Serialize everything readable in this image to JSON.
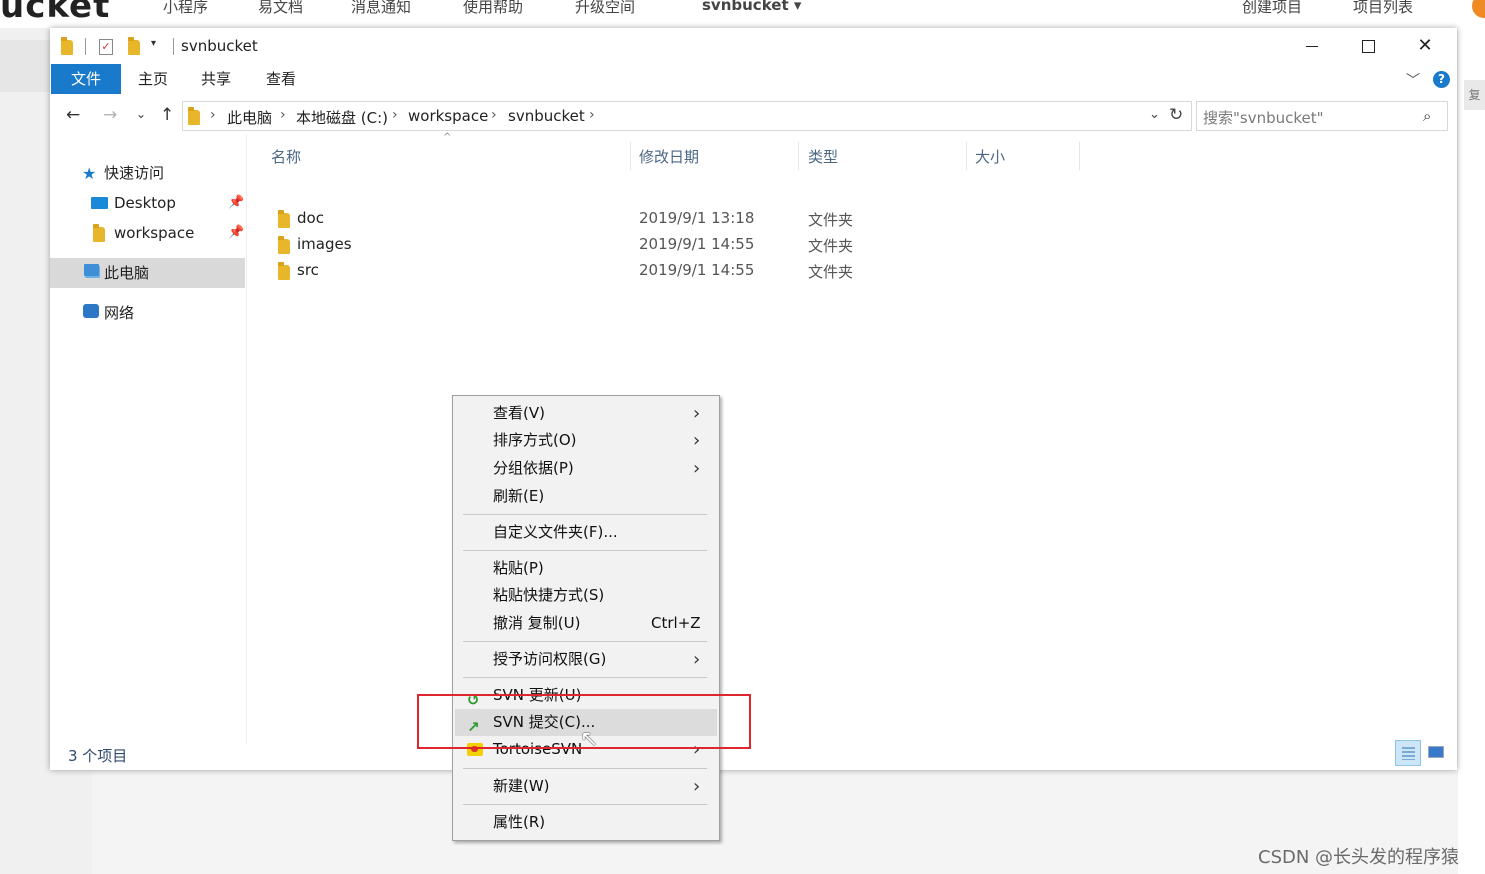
{
  "background_page": {
    "brand": "ucket",
    "nav": [
      "小程序",
      "易文档",
      "消息通知",
      "使用帮助",
      "升级空间",
      "svnbucket ▾"
    ],
    "right_nav": [
      "创建项目",
      "项目列表"
    ],
    "right_chip": "复"
  },
  "window": {
    "title": "svnbucket",
    "quick_access_dropdown": "▾",
    "controls": {
      "close": "✕"
    }
  },
  "ribbon": {
    "tabs": [
      "文件",
      "主页",
      "共享",
      "查看"
    ],
    "expand_icon": "﹀",
    "help": "?"
  },
  "nav": {
    "back": "←",
    "forward": "→",
    "recent": "⌄",
    "up": "↑",
    "breadcrumb": [
      "此电脑",
      "本地磁盘 (C:)",
      "workspace",
      "svnbucket"
    ],
    "crumb_separator": "›",
    "address_dropdown": "⌄",
    "refresh": "↻",
    "search_placeholder": "搜索\"svnbucket\"",
    "search_icon": "⌕"
  },
  "sidebar": {
    "quick_access": "快速访问",
    "star": "★",
    "pin": "📌",
    "items": [
      "Desktop",
      "workspace"
    ],
    "this_pc": "此电脑",
    "network": "网络"
  },
  "list": {
    "sort_indicator": "^",
    "columns": [
      "名称",
      "修改日期",
      "类型",
      "大小"
    ],
    "rows": [
      {
        "name": "doc",
        "date": "2019/9/1 13:18",
        "type": "文件夹"
      },
      {
        "name": "images",
        "date": "2019/9/1 14:55",
        "type": "文件夹"
      },
      {
        "name": "src",
        "date": "2019/9/1 14:55",
        "type": "文件夹"
      }
    ]
  },
  "status": {
    "count": "3 个项目"
  },
  "context_menu": {
    "submenu_arrow": "›",
    "svn_update_glyph": "↺",
    "svn_commit_glyph": "↗",
    "items": [
      {
        "label": "查看(V)"
      },
      {
        "label": "排序方式(O)"
      },
      {
        "label": "分组依据(P)"
      },
      {
        "label": "刷新(E)"
      },
      {
        "label": "自定义文件夹(F)..."
      },
      {
        "label": "粘贴(P)"
      },
      {
        "label": "粘贴快捷方式(S)"
      },
      {
        "label": "撤消 复制(U)",
        "shortcut": "Ctrl+Z"
      },
      {
        "label": "授予访问权限(G)"
      },
      {
        "label": "SVN 更新(U)"
      },
      {
        "label": "SVN 提交(C)..."
      },
      {
        "label": "TortoiseSVN"
      },
      {
        "label": "新建(W)"
      },
      {
        "label": "属性(R)"
      }
    ]
  },
  "cursor_glyph": "↖",
  "watermark": "CSDN @长头发的程序猿",
  "colors": {
    "accent": "#1979ca",
    "highlight": "#e0262d",
    "folder": "#e8b62b"
  }
}
